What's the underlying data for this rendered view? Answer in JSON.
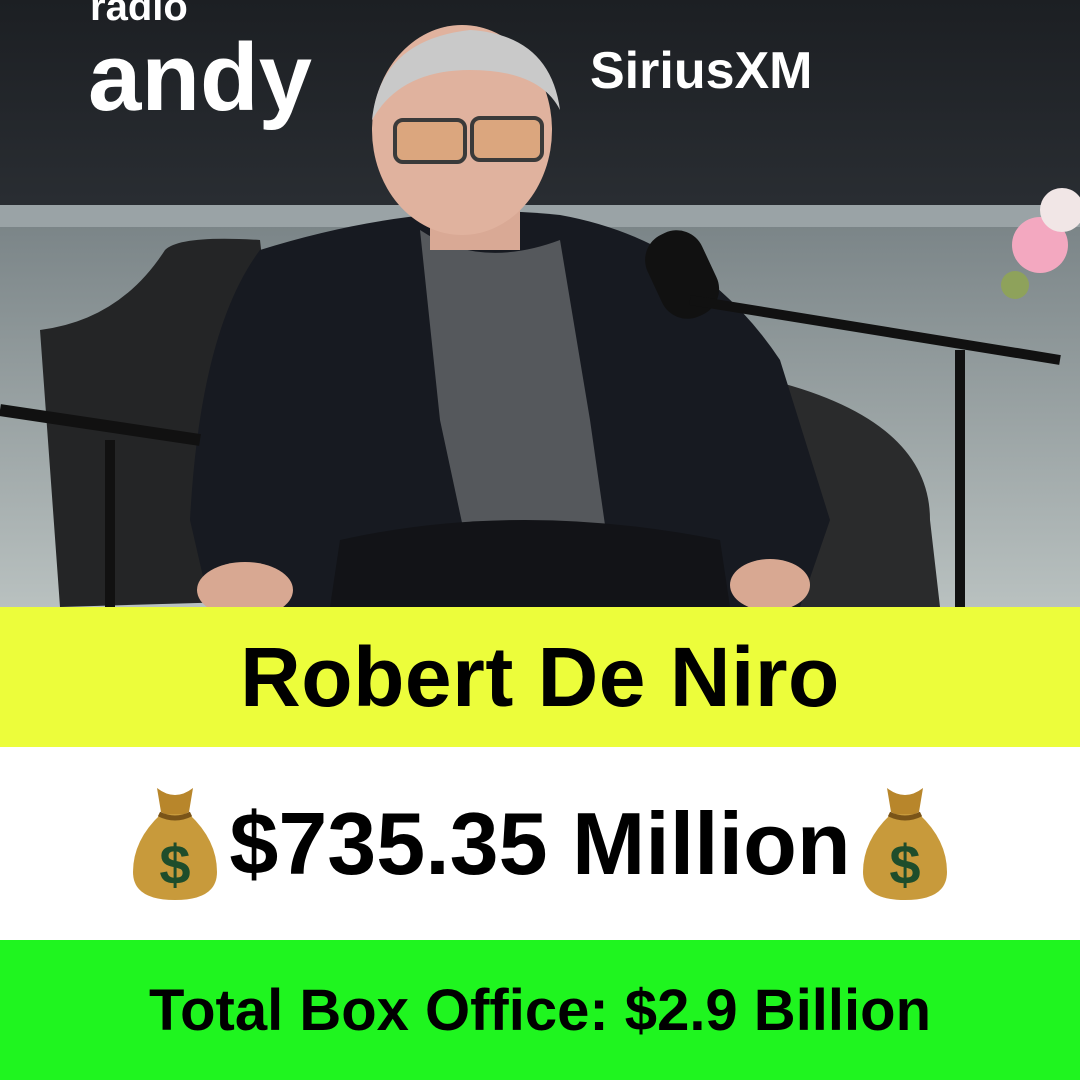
{
  "photo": {
    "logo_small": "radio",
    "logo_main": "andy",
    "sponsor": "SiriusXM",
    "icons": [
      "microphone-icon",
      "flowers",
      "person-photo"
    ]
  },
  "name_band": {
    "name": "Robert De Niro",
    "color": "#ecfd3b"
  },
  "worth_band": {
    "value": "$735.35 Million",
    "icon": "money-bag-icon",
    "color": "#ffffff"
  },
  "box_band": {
    "label": "Total Box Office: $2.9 Billion",
    "color": "#1ff51f"
  }
}
